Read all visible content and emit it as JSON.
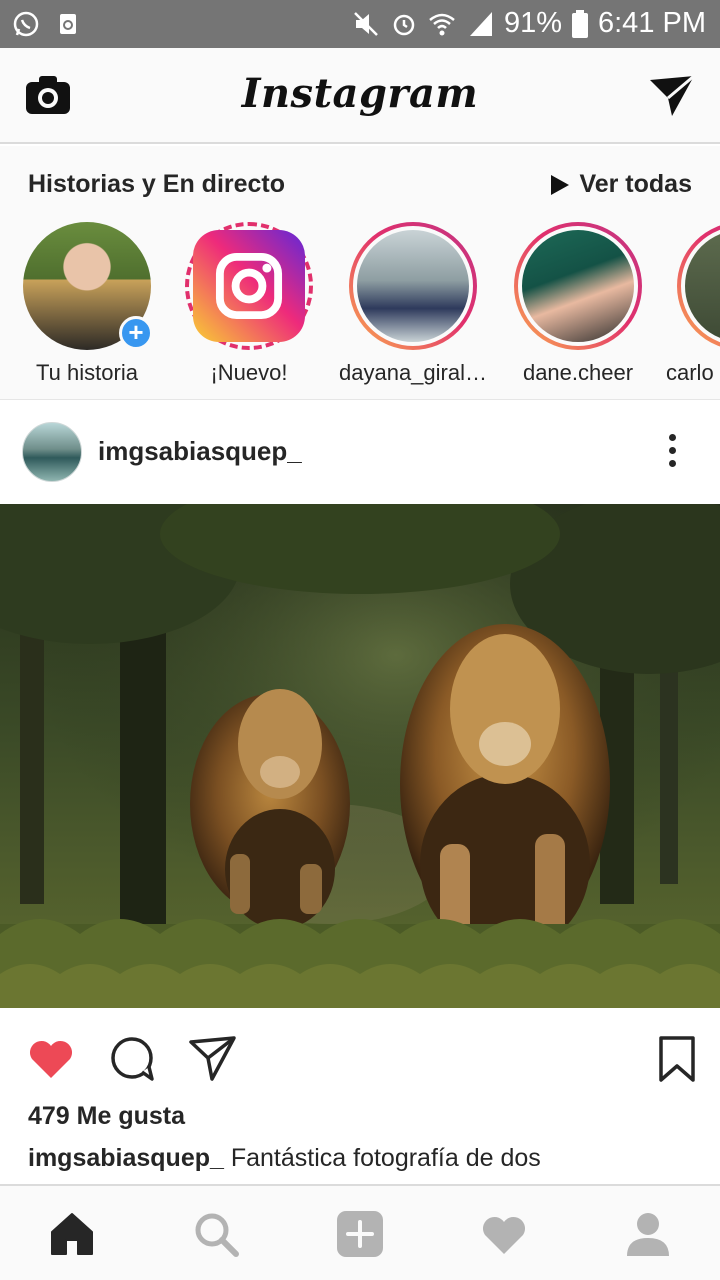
{
  "status_bar": {
    "battery": "91%",
    "time": "6:41 PM",
    "icons": [
      "whatsapp-icon",
      "recycle-icon",
      "mute-icon",
      "alarm-icon",
      "wifi-icon",
      "signal-icon",
      "battery-icon"
    ]
  },
  "header": {
    "logo": "Instagram",
    "icons": [
      "camera-icon",
      "direct-message-icon"
    ]
  },
  "stories": {
    "title": "Historias y En directo",
    "see_all": "Ver todas",
    "items": [
      {
        "label": "Tu historia"
      },
      {
        "label": "¡Nuevo!"
      },
      {
        "label": "dayana_giral…"
      },
      {
        "label": "dane.cheer"
      },
      {
        "label": "carlo"
      }
    ],
    "ring_colors": [
      "#fbad50",
      "#e1306c",
      "#c13584"
    ]
  },
  "post": {
    "username": "imgsabiasquep_",
    "likes": "479 Me gusta",
    "caption_user": "imgsabiasquep_",
    "caption_text": " Fantástica fotografía de dos",
    "liked": true,
    "like_color": "#ed4956"
  },
  "bottom_nav": {
    "items": [
      "home-icon",
      "search-icon",
      "add-post-icon",
      "activity-heart-icon",
      "profile-icon"
    ],
    "active": "home-icon"
  }
}
